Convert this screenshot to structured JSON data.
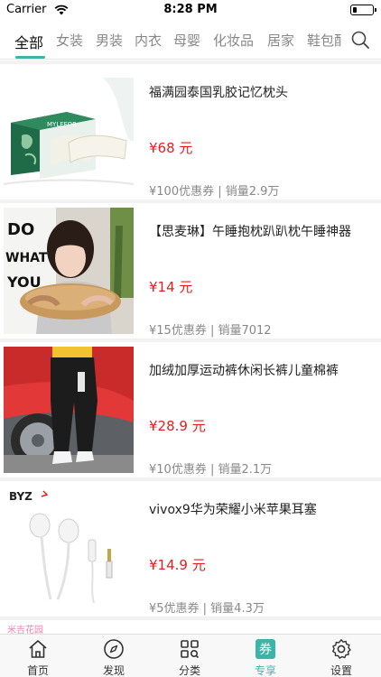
{
  "status_bar": {
    "carrier": "Carrier",
    "time": "8:28 PM"
  },
  "tabs": [
    {
      "label": "全部",
      "active": true
    },
    {
      "label": "女装"
    },
    {
      "label": "男装"
    },
    {
      "label": "内衣"
    },
    {
      "label": "母婴"
    },
    {
      "label": "化妆品"
    },
    {
      "label": "居家"
    },
    {
      "label": "鞋包配"
    }
  ],
  "products": [
    {
      "title": "福满园泰国乳胶记忆枕头",
      "price": "¥68 元",
      "meta": "¥100优惠券 | 销量2.9万"
    },
    {
      "title": "【思麦琳】午睡抱枕趴趴枕午睡神器",
      "price": "¥14 元",
      "meta": "¥15优惠券 | 销量7012"
    },
    {
      "title": "加绒加厚运动裤休闲长裤儿童棉裤",
      "price": "¥28.9 元",
      "meta": "¥10优惠券 | 销量2.1万"
    },
    {
      "title": "vivox9华为荣耀小米苹果耳塞",
      "price": "¥14.9 元",
      "meta": "¥5优惠券 | 销量4.3万"
    }
  ],
  "product_images": {
    "pillow_box_brand": "MYLEFOR",
    "earphone_brand": "BYZ"
  },
  "peek_text": "米吉花园",
  "bottom_nav": [
    {
      "label": "首页",
      "icon": "home-icon"
    },
    {
      "label": "发现",
      "icon": "compass-icon"
    },
    {
      "label": "分类",
      "icon": "category-icon"
    },
    {
      "label": "专享",
      "icon": "coupon-icon",
      "active": true,
      "glyph": "券"
    },
    {
      "label": "设置",
      "icon": "settings-icon"
    }
  ],
  "colors": {
    "accent": "#3cb5a8",
    "price": "#e02020",
    "muted": "#888888",
    "divider": "#f2f2f2"
  }
}
